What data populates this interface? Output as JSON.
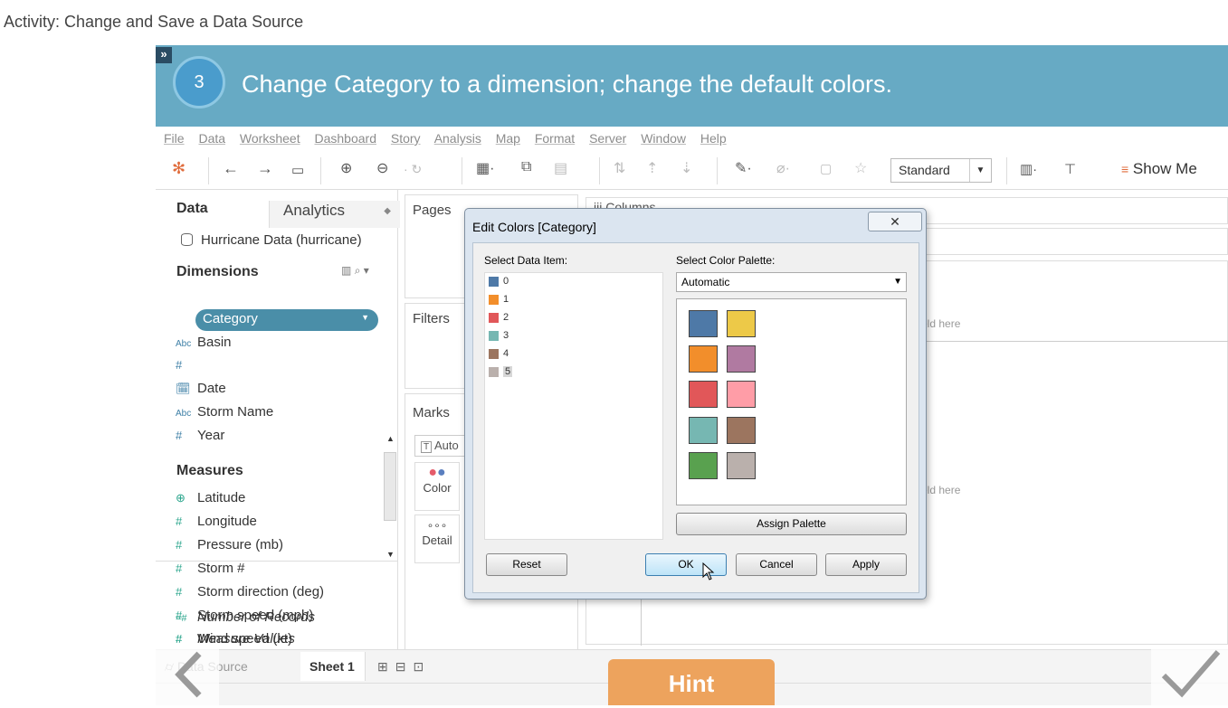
{
  "activity_title": "Activity: Change and Save a Data Source",
  "step": {
    "number": "3",
    "instruction": "Change Category to a dimension; change the default colors."
  },
  "menu": [
    "File",
    "Data",
    "Worksheet",
    "Dashboard",
    "Story",
    "Analysis",
    "Map",
    "Format",
    "Server",
    "Window",
    "Help"
  ],
  "toolbar": {
    "fit_select": "Standard",
    "show_me": "Show Me"
  },
  "data_pane": {
    "tab_data": "Data",
    "tab_analytics": "Analytics",
    "data_source": "Hurricane Data (hurricane)",
    "dimensions_header": "Dimensions",
    "dimensions": [
      {
        "icon": "Abc",
        "label": "Basin"
      },
      {
        "icon": "#",
        "label": "Category"
      },
      {
        "icon": "date",
        "label": "Date"
      },
      {
        "icon": "Abc",
        "label": "Storm Name"
      },
      {
        "icon": "#",
        "label": "Year"
      }
    ],
    "measures_header": "Measures",
    "measures": [
      {
        "icon": "globe",
        "label": "Latitude"
      },
      {
        "icon": "#",
        "label": "Longitude"
      },
      {
        "icon": "#",
        "label": "Pressure (mb)"
      },
      {
        "icon": "#",
        "label": "Storm #"
      },
      {
        "icon": "#",
        "label": "Storm direction (deg)"
      },
      {
        "icon": "#",
        "label": "Storm speed (mph)"
      },
      {
        "icon": "#",
        "label": "Wind speed (kt)"
      },
      {
        "icon": "=#",
        "label": "Number of Records"
      },
      {
        "icon": "#",
        "label": "Measure Values"
      }
    ]
  },
  "shelves": {
    "pages": "Pages",
    "filters": "Filters",
    "marks": "Marks",
    "marks_type": "Auto",
    "color": "Color",
    "detail": "Detail",
    "columns": "Columns",
    "drop_hint": "eld here"
  },
  "dialog": {
    "title": "Edit Colors [Category]",
    "select_data_item": "Select Data Item:",
    "select_color_palette": "Select Color Palette:",
    "palette_value": "Automatic",
    "items": [
      {
        "label": "0",
        "color": "#4e79a7"
      },
      {
        "label": "1",
        "color": "#f28e2b"
      },
      {
        "label": "2",
        "color": "#e15759"
      },
      {
        "label": "3",
        "color": "#76b7b2"
      },
      {
        "label": "4",
        "color": "#9c755f"
      },
      {
        "label": "5",
        "color": "#bab0ac"
      }
    ],
    "palette_colors": [
      "#4e79a7",
      "#edc948",
      "#f28e2b",
      "#b07aa1",
      "#e15759",
      "#ff9da7",
      "#76b7b2",
      "#9c755f",
      "#59a14f",
      "#bab0ac"
    ],
    "assign_palette": "Assign Palette",
    "reset": "Reset",
    "ok": "OK",
    "cancel": "Cancel",
    "apply": "Apply"
  },
  "bottom": {
    "data_source_tab": "Data Source",
    "sheet_tab": "Sheet 1",
    "hint": "Hint"
  },
  "colors": {
    "banner": "#67aac4",
    "hint": "#eda35d",
    "category_pill": "#4a8ea8"
  }
}
